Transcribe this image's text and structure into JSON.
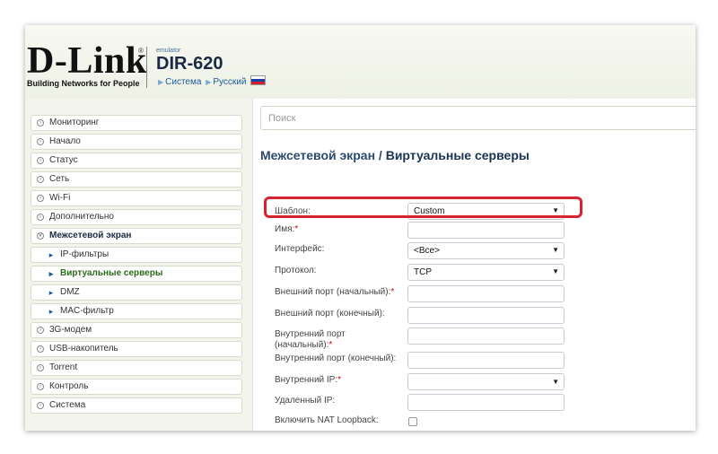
{
  "header": {
    "logo_text": "D-Link",
    "logo_reg": "®",
    "logo_tagline": "Building Networks for People",
    "emulator_label": "emulator",
    "model": "DIR-620",
    "breadcrumb": [
      "Система",
      "Русский"
    ]
  },
  "sidebar": {
    "items": [
      {
        "label": "Мониторинг"
      },
      {
        "label": "Начало"
      },
      {
        "label": "Статус"
      },
      {
        "label": "Сеть"
      },
      {
        "label": "Wi-Fi"
      },
      {
        "label": "Дополнительно"
      },
      {
        "label": "Межсетевой экран"
      },
      {
        "label": "IP-фильтры"
      },
      {
        "label": "Виртуальные серверы"
      },
      {
        "label": "DMZ"
      },
      {
        "label": "MAC-фильтр"
      },
      {
        "label": "3G-модем"
      },
      {
        "label": "USB-накопитель"
      },
      {
        "label": "Torrent"
      },
      {
        "label": "Контроль"
      },
      {
        "label": "Система"
      }
    ]
  },
  "search": {
    "placeholder": "Поиск"
  },
  "page": {
    "title_part1": "Межсетевой экран /",
    "title_part2": "Виртуальные серверы"
  },
  "form": {
    "template_label": "Шаблон:",
    "template_value": "Custom",
    "name_label": "Имя:",
    "name_value": "",
    "interface_label": "Интерфейс:",
    "interface_value": "<Все>",
    "protocol_label": "Протокол:",
    "protocol_value": "TCP",
    "ext_port_start_label": "Внешний порт (начальный):",
    "ext_port_end_label": "Внешний порт (конечный):",
    "int_port_start_label": "Внутренний порт (начальный):",
    "int_port_end_label": "Внутренний порт (конечный):",
    "int_ip_label": "Внутренний IP:",
    "remote_ip_label": "Удаленный IP:",
    "nat_loopback_label": "Включить NAT Loopback:",
    "required_mark": "*",
    "select_arrow": "▼"
  },
  "colors": {
    "highlight": "#d8242e",
    "title": "#2c4a6e"
  }
}
